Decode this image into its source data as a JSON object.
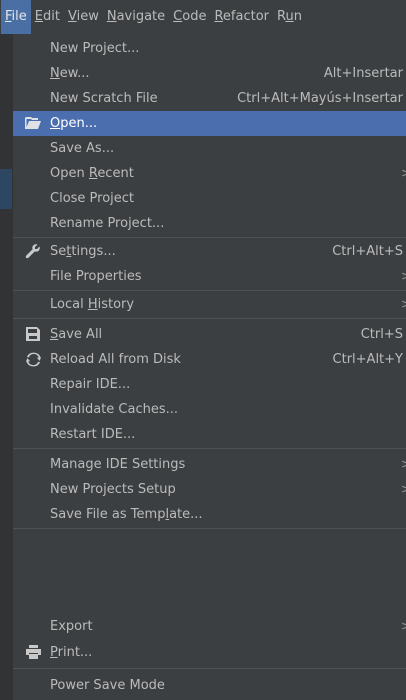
{
  "menubar": [
    {
      "pre": "",
      "u": "F",
      "post": "ile",
      "active": true
    },
    {
      "pre": "",
      "u": "E",
      "post": "dit"
    },
    {
      "pre": "",
      "u": "V",
      "post": "iew"
    },
    {
      "pre": "",
      "u": "N",
      "post": "avigate"
    },
    {
      "pre": "",
      "u": "C",
      "post": "ode"
    },
    {
      "pre": "",
      "u": "R",
      "post": "efactor"
    },
    {
      "pre": "R",
      "u": "u",
      "post": "n"
    }
  ],
  "file_menu": {
    "new_project": "New Project...",
    "new": {
      "u": "N",
      "rest": "ew..."
    },
    "new_shortcut": "Alt+Insertar",
    "new_scratch": "New Scratch File",
    "new_scratch_shortcut": "Ctrl+Alt+Mayús+Insertar",
    "open": {
      "u": "O",
      "rest": "pen..."
    },
    "save_as": "Save As...",
    "open_recent": {
      "pre": "Open ",
      "u": "R",
      "rest": "ecent"
    },
    "close_project": "Close Project",
    "rename_project": "Rename Project...",
    "settings": {
      "pre": "Se",
      "u": "t",
      "rest": "tings..."
    },
    "settings_shortcut": "Ctrl+Alt+S",
    "file_properties": "File Properties",
    "local_history": {
      "pre": "Local ",
      "u": "H",
      "rest": "istory"
    },
    "save_all": {
      "u": "S",
      "rest": "ave All"
    },
    "save_all_shortcut": "Ctrl+S",
    "reload_all": "Reload All from Disk",
    "reload_all_shortcut": "Ctrl+Alt+Y",
    "repair_ide": "Repair IDE...",
    "invalidate_caches": "Invalidate Caches...",
    "restart_ide": "Restart IDE...",
    "manage_ide_settings": "Manage IDE Settings",
    "new_projects_setup": "New Projects Setup",
    "save_as_template": {
      "pre": "Save File as Temp",
      "u": "l",
      "rest": "ate..."
    },
    "export": "Export",
    "print": {
      "u": "P",
      "rest": "rint..."
    },
    "power_save_mode": "Power Save Mode",
    "submenu_arrow": ">"
  },
  "colors": {
    "menu_bg": "#3c3f41",
    "selection": "#4b6eaf",
    "text": "#bbbbbb",
    "separator": "#515151"
  },
  "icons": [
    "folder-open-icon",
    "wrench-icon",
    "save-disk-icon",
    "reload-icon",
    "printer-icon"
  ]
}
